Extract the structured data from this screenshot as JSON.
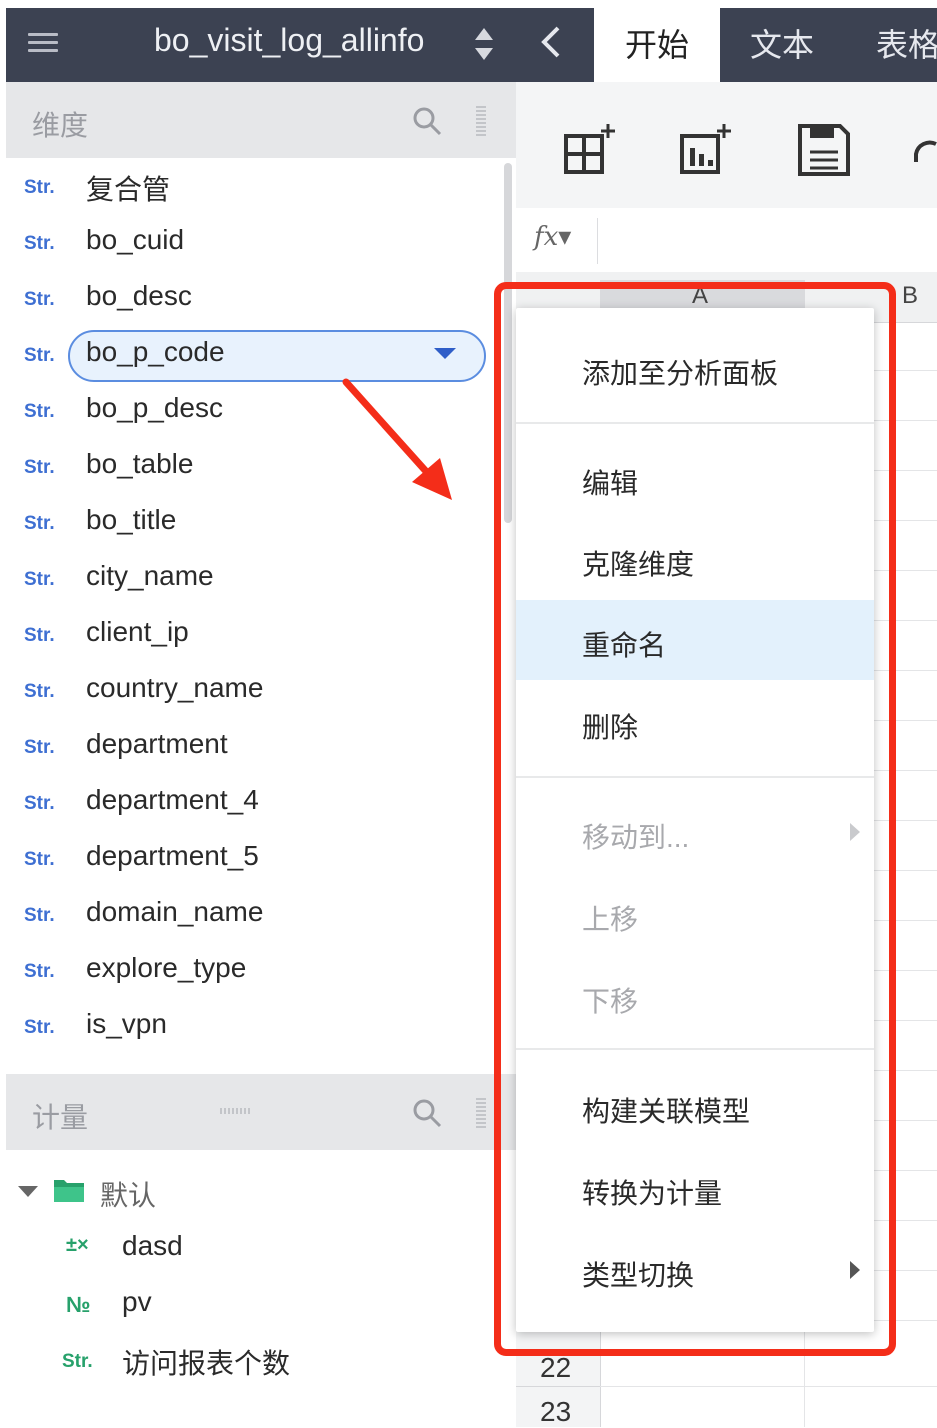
{
  "left": {
    "dataset_title": "bo_visit_log_allinfo",
    "dimension_header": "维度",
    "measure_header": "计量",
    "dimensions": [
      {
        "type": "Str.",
        "name": "复合管"
      },
      {
        "type": "Str.",
        "name": "bo_cuid"
      },
      {
        "type": "Str.",
        "name": "bo_desc"
      },
      {
        "type": "Str.",
        "name": "bo_p_code"
      },
      {
        "type": "Str.",
        "name": "bo_p_desc"
      },
      {
        "type": "Str.",
        "name": "bo_table"
      },
      {
        "type": "Str.",
        "name": "bo_title"
      },
      {
        "type": "Str.",
        "name": "city_name"
      },
      {
        "type": "Str.",
        "name": "client_ip"
      },
      {
        "type": "Str.",
        "name": "country_name"
      },
      {
        "type": "Str.",
        "name": "department"
      },
      {
        "type": "Str.",
        "name": "department_4"
      },
      {
        "type": "Str.",
        "name": "department_5"
      },
      {
        "type": "Str.",
        "name": "domain_name"
      },
      {
        "type": "Str.",
        "name": "explore_type"
      },
      {
        "type": "Str.",
        "name": "is_vpn"
      }
    ],
    "measure_folder": "默认",
    "measures": [
      {
        "type": "±×",
        "name": "dasd"
      },
      {
        "type": "№",
        "name": "pv"
      },
      {
        "type": "Str.",
        "name": "访问报表个数"
      }
    ]
  },
  "right": {
    "tabs": [
      "开始",
      "文本",
      "表格"
    ],
    "columns": [
      "A",
      "B"
    ],
    "row_numbers": [
      "22",
      "23"
    ]
  },
  "context_menu": {
    "add_to_panel": "添加至分析面板",
    "edit": "编辑",
    "clone": "克隆维度",
    "rename": "重命名",
    "delete": "删除",
    "move_to": "移动到...",
    "move_up": "上移",
    "move_down": "下移",
    "build_model": "构建关联模型",
    "convert": "转换为计量",
    "type_switch": "类型切换"
  },
  "colors": {
    "topbar": "#3c4252",
    "accent_blue": "#3e6fd2",
    "highlight_red": "#f42d19",
    "hover_row": "#e3f1fc"
  }
}
